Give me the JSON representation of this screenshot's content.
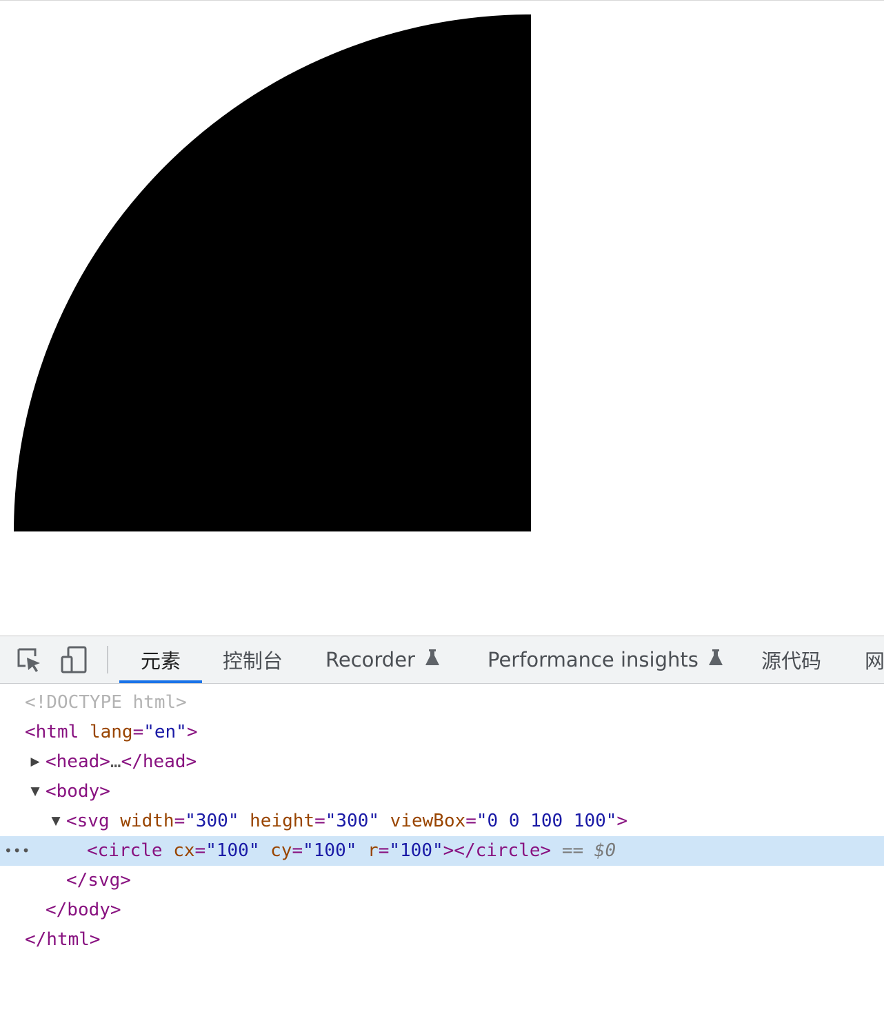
{
  "viewport": {
    "shape": {
      "kind": "circle",
      "fill": "#000000"
    }
  },
  "devtools": {
    "toolbar": {
      "inspect_icon": "inspect-element-icon",
      "device_icon": "device-toolbar-icon",
      "tabs": [
        {
          "label": "元素",
          "active": true
        },
        {
          "label": "控制台",
          "active": false
        },
        {
          "label": "Recorder",
          "active": false,
          "icon": "flask-icon"
        },
        {
          "label": "Performance insights",
          "active": false,
          "icon": "flask-icon"
        },
        {
          "label": "源代码",
          "active": false
        },
        {
          "label": "网",
          "active": false
        }
      ]
    },
    "tree": {
      "doctype": "<!DOCTYPE html>",
      "html_open": {
        "tag": "<html",
        "attr": "lang",
        "value": "\"en\"",
        "close": ">"
      },
      "head": {
        "open": "<head>",
        "ellipsis": "…",
        "close": "</head>"
      },
      "body_open": "<body>",
      "svg_open": {
        "tag": "<svg",
        "attrs": [
          {
            "name": "width",
            "value": "\"300\""
          },
          {
            "name": "height",
            "value": "\"300\""
          },
          {
            "name": "viewBox",
            "value": "\"0 0 100 100\""
          }
        ],
        "close": ">"
      },
      "circle": {
        "tag": "<circle",
        "attrs": [
          {
            "name": "cx",
            "value": "\"100\""
          },
          {
            "name": "cy",
            "value": "\"100\""
          },
          {
            "name": "r",
            "value": "\"100\""
          }
        ],
        "close": "></circle>",
        "selected_marker": "== $0"
      },
      "svg_close": "</svg>",
      "body_close": "</body>",
      "html_close": "</html>",
      "row_menu": "•••"
    }
  }
}
